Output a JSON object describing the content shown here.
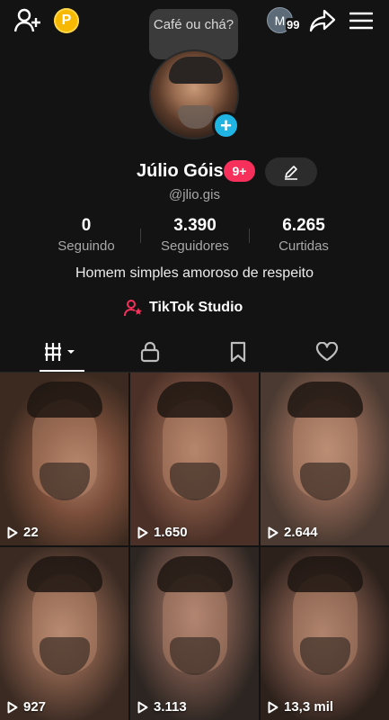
{
  "topbar": {
    "coin_label": "P",
    "note_text": "Café ou chá?",
    "mini_avatar_letter": "M",
    "mini_avatar_count": "99"
  },
  "profile": {
    "name": "Júlio Góis",
    "notification_badge": "9+",
    "handle": "@jlio.gis",
    "bio": "Homem simples amoroso de respeito",
    "studio_label": "TikTok Studio"
  },
  "stats": [
    {
      "value": "0",
      "label": "Seguindo"
    },
    {
      "value": "3.390",
      "label": "Seguidores"
    },
    {
      "value": "6.265",
      "label": "Curtidas"
    }
  ],
  "tabs": {
    "active": "videos",
    "items": [
      "videos-grid",
      "private",
      "saved",
      "liked"
    ]
  },
  "videos": [
    {
      "views": "22"
    },
    {
      "views": "1.650"
    },
    {
      "views": "2.644"
    },
    {
      "views": "927"
    },
    {
      "views": "3.113"
    },
    {
      "views": "13,3 mil"
    }
  ],
  "colors": {
    "background": "#131313",
    "accent_pink": "#f6305b",
    "accent_blue": "#20b4e3",
    "coin_gold": "#f6b800",
    "muted_text": "#a8a8a8"
  }
}
